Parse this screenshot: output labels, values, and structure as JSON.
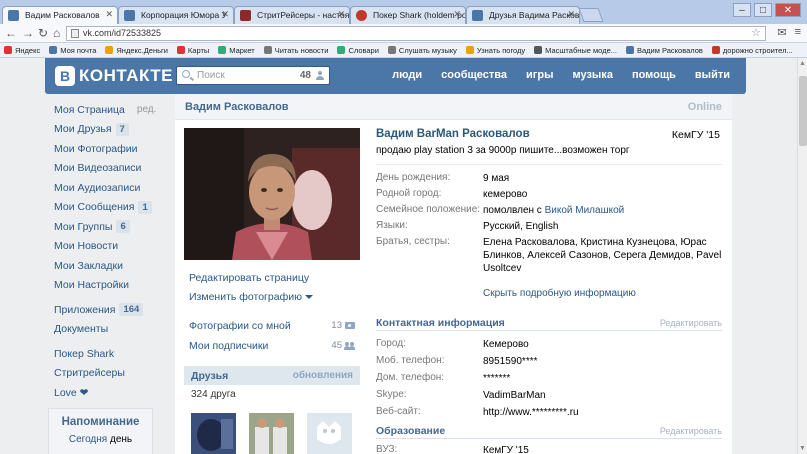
{
  "browser": {
    "tabs": [
      {
        "label": "Вадим Расковалов",
        "favicon_color": "#4a76a8",
        "active": true
      },
      {
        "label": "Корпорация Юмора У",
        "favicon_color": "#4a76a8",
        "active": false
      },
      {
        "label": "СтритРейсеры - настоящ",
        "favicon_color": "#8b2a2a",
        "active": false
      },
      {
        "label": "Покер Shark (holdem poke",
        "favicon_color": "#c0392b",
        "active": false
      },
      {
        "label": "Друзья Вадима Расковало",
        "favicon_color": "#4a76a8",
        "active": false
      }
    ],
    "url": "vk.com/id72533825",
    "bookmarks": [
      {
        "label": "Яндекс",
        "color": "#d33"
      },
      {
        "label": "Моя почта",
        "color": "#4a76a8"
      },
      {
        "label": "Яндекс.Деньги",
        "color": "#e8a400"
      },
      {
        "label": "Карты",
        "color": "#d33"
      },
      {
        "label": "Маркет",
        "color": "#3a7"
      },
      {
        "label": "Читать новости",
        "color": "#777"
      },
      {
        "label": "Словари",
        "color": "#3a7"
      },
      {
        "label": "Слушать музыку",
        "color": "#777"
      },
      {
        "label": "Узнать погоду",
        "color": "#e8a400"
      },
      {
        "label": "Масштабные моде...",
        "color": "#555"
      },
      {
        "label": "Вадим Расковалов",
        "color": "#4a76a8"
      },
      {
        "label": "дорожно строител...",
        "color": "#c0392b"
      }
    ]
  },
  "header": {
    "logo_letter": "В",
    "logo_text": "КОНТАКТЕ",
    "search_placeholder": "Поиск",
    "search_count": "48",
    "nav": [
      "люди",
      "сообщества",
      "игры",
      "музыка",
      "помощь",
      "выйти"
    ]
  },
  "left_menu": {
    "items": [
      {
        "label": "Моя Страница",
        "edit": "ред."
      },
      {
        "label": "Мои Друзья",
        "badge": "7"
      },
      {
        "label": "Мои Фотографии"
      },
      {
        "label": "Мои Видеозаписи"
      },
      {
        "label": "Мои Аудиозаписи"
      },
      {
        "label": "Мои Сообщения",
        "badge": "1"
      },
      {
        "label": "Мои Группы",
        "badge": "6"
      },
      {
        "label": "Мои Новости"
      },
      {
        "label": "Мои Закладки"
      },
      {
        "label": "Мои Настройки"
      }
    ],
    "extra": [
      {
        "label": "Приложения",
        "badge": "164"
      },
      {
        "label": "Документы"
      }
    ],
    "apps": [
      {
        "label": "Покер Shark"
      },
      {
        "label": "Стритрейсеры"
      },
      {
        "label": "Love ❤"
      }
    ],
    "reminder_title": "Напоминание",
    "reminder_link": "Сегодня",
    "reminder_text": "день"
  },
  "profile": {
    "page_title": "Вадим Расковалов",
    "online": "Online",
    "full_name": "Вадим BarMan Расковалов",
    "university_short": "КемГУ '15",
    "status": "продаю play station 3 за 9000р пишите...возможен торг",
    "edit_page": "Редактировать страницу",
    "change_photo": "Изменить фотографию",
    "photos_with_me": "Фотографии со мной",
    "photos_with_me_count": "13",
    "my_followers": "Мои подписчики",
    "my_followers_count": "45",
    "friends_title": "Друзья",
    "friends_updates": "обновления",
    "friends_count": "324 друга",
    "info": {
      "birthday_label": "День рождения:",
      "birthday": "9 мая",
      "hometown_label": "Родной город:",
      "hometown": "кемерово",
      "marital_label": "Семейное положение:",
      "marital_prefix": "помолвлен с ",
      "marital_partner": "Викой Милашкой",
      "languages_label": "Языки:",
      "languages": "Русский, English",
      "siblings_label": "Братья, сестры:",
      "siblings": "Елена Расковалова, Кристина Кузнецова, Юрас Блинков, Алексей Сазонов, Серега Демидов, Pavel Usoltcev",
      "show_more": "Скрыть подробную информацию"
    },
    "contacts": {
      "title": "Контактная информация",
      "edit": "Редактировать",
      "city_label": "Город:",
      "city": "Кемерово",
      "mobile_label": "Моб. телефон:",
      "mobile": "8951590****",
      "home_label": "Дом. телефон:",
      "home": "*******",
      "skype_label": "Skype:",
      "skype": "VadimBarMan",
      "web_label": "Веб-сайт:",
      "web": "http://www.*********.ru"
    },
    "education": {
      "title": "Образование",
      "edit": "Редактировать",
      "vuz_label": "ВУЗ:",
      "vuz": "КемГУ '15"
    }
  }
}
